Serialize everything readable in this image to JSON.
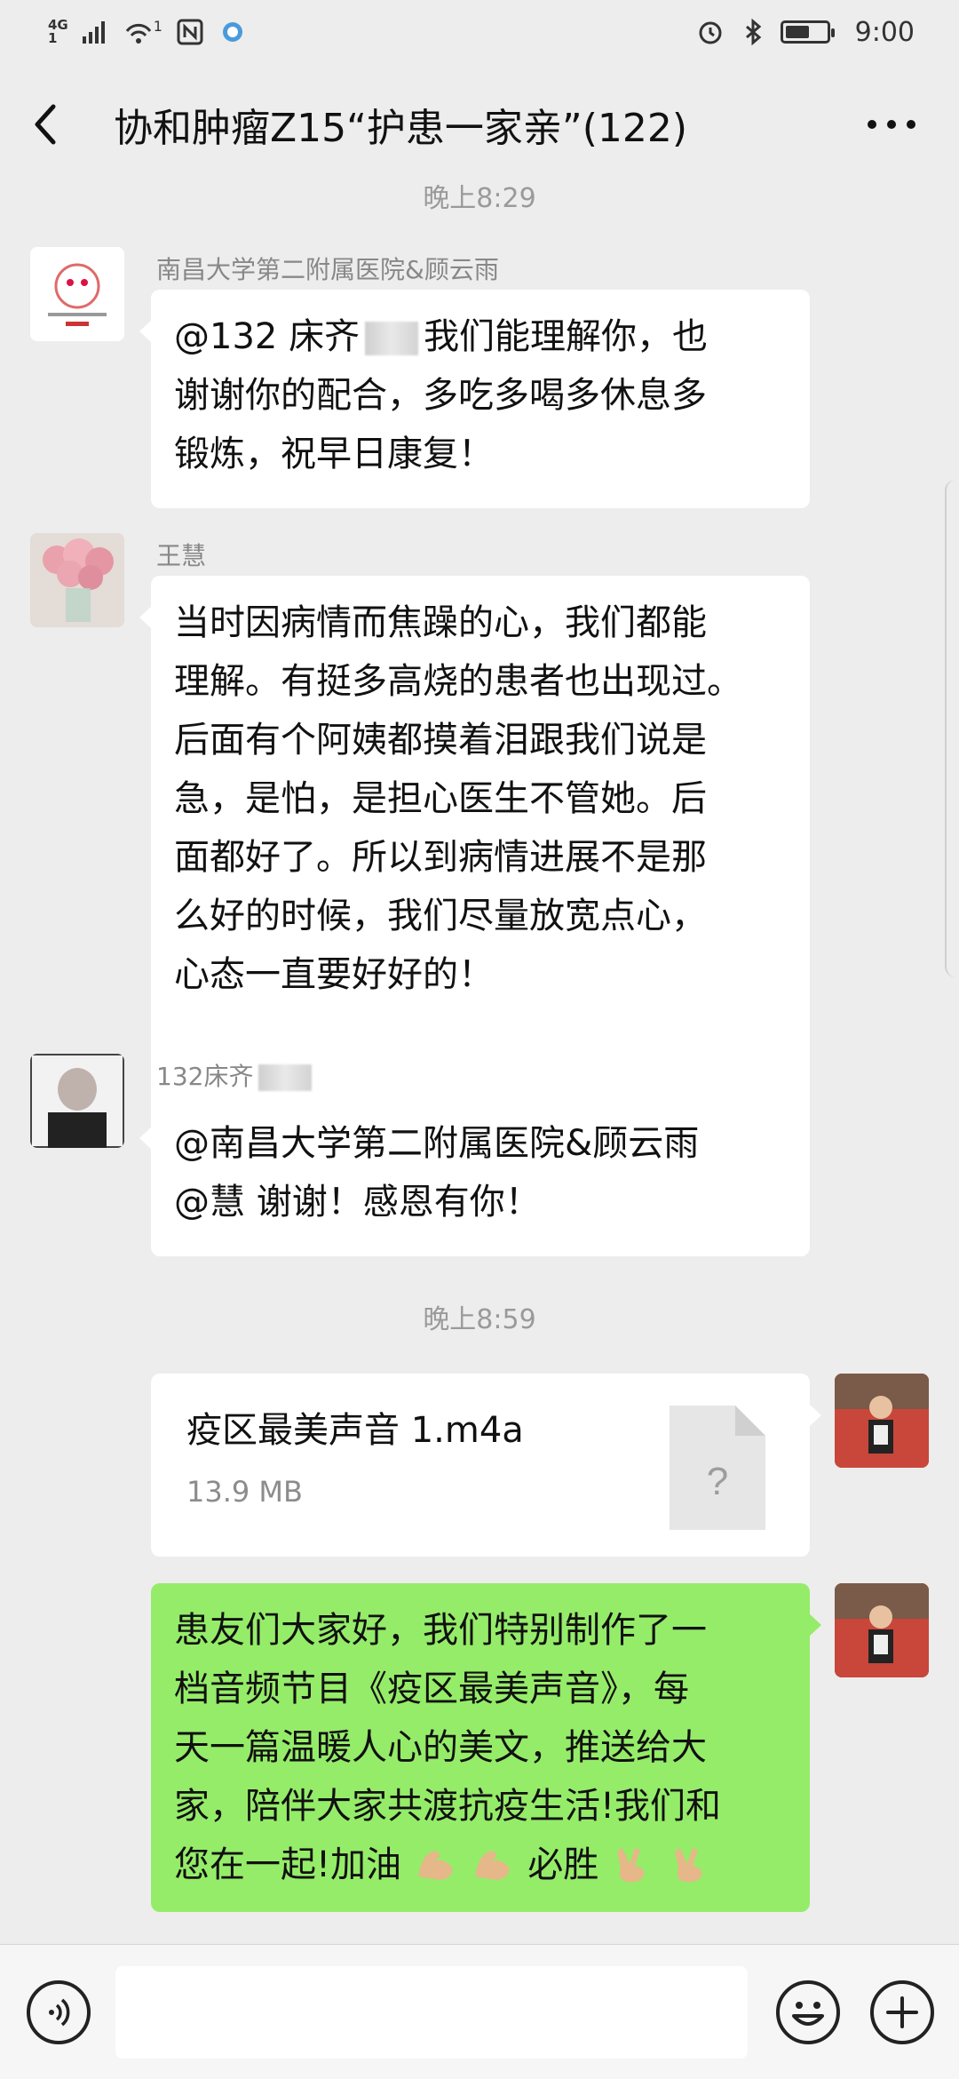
{
  "status_bar": {
    "network": [
      "4G",
      "1"
    ],
    "wifi_sup": "1",
    "time": "9:00",
    "battery_level": 0.6,
    "icons": [
      "signal-icon",
      "wifi-icon",
      "nfc-icon",
      "app-icon",
      "alarm-icon",
      "bluetooth-icon",
      "battery-icon"
    ]
  },
  "header": {
    "title": "协和肿瘤Z15“护患一家亲”(122)",
    "back_icon": "chevron-left-icon",
    "more_icon": "more-icon"
  },
  "messages": {
    "time_top": "晚上8:29",
    "msg1": {
      "sender": "南昌大学第二附属医院&顾云雨",
      "line1_a": "@132 床齐",
      "line1_b": "我们能理解你，也",
      "line2": "谢谢你的配合，多吃多喝多休息多",
      "line3": "锻炼，祝早日康复！"
    },
    "msg2": {
      "sender": "王慧",
      "lines": [
        "当时因病情而焦躁的心，我们都能",
        "理解。有挺多高烧的患者也出现过。",
        "后面有个阿姨都摸着泪跟我们说是",
        "急，是怕，是担心医生不管她。后",
        "面都好了。所以到病情进展不是那",
        "么好的时候，我们尽量放宽点心，",
        "心态一直要好好的！"
      ]
    },
    "msg3": {
      "sender": "132床齐",
      "lines": [
        "@南昌大学第二附属医院&顾云雨",
        "@慧  谢谢！感恩有你！"
      ]
    },
    "time_mid": "晚上8:59",
    "file_msg": {
      "name": "疫区最美声音 1.m4a",
      "size": "13.9 MB",
      "icon": "unknown-file-icon",
      "icon_text": "?"
    },
    "msg_me": {
      "lines": [
        "患友们大家好，我们特别制作了一",
        "档音频节目《疫区最美声音》，每",
        "天一篇温暖人心的美文，推送给大",
        "家，陪伴大家共渡抗疫生活!我们和"
      ],
      "last_a": "您在一起!加油",
      "last_b": "必胜"
    }
  },
  "input_bar": {
    "voice_icon": "voice-icon",
    "emoji_icon": "emoji-icon",
    "plus_icon": "plus-icon"
  }
}
